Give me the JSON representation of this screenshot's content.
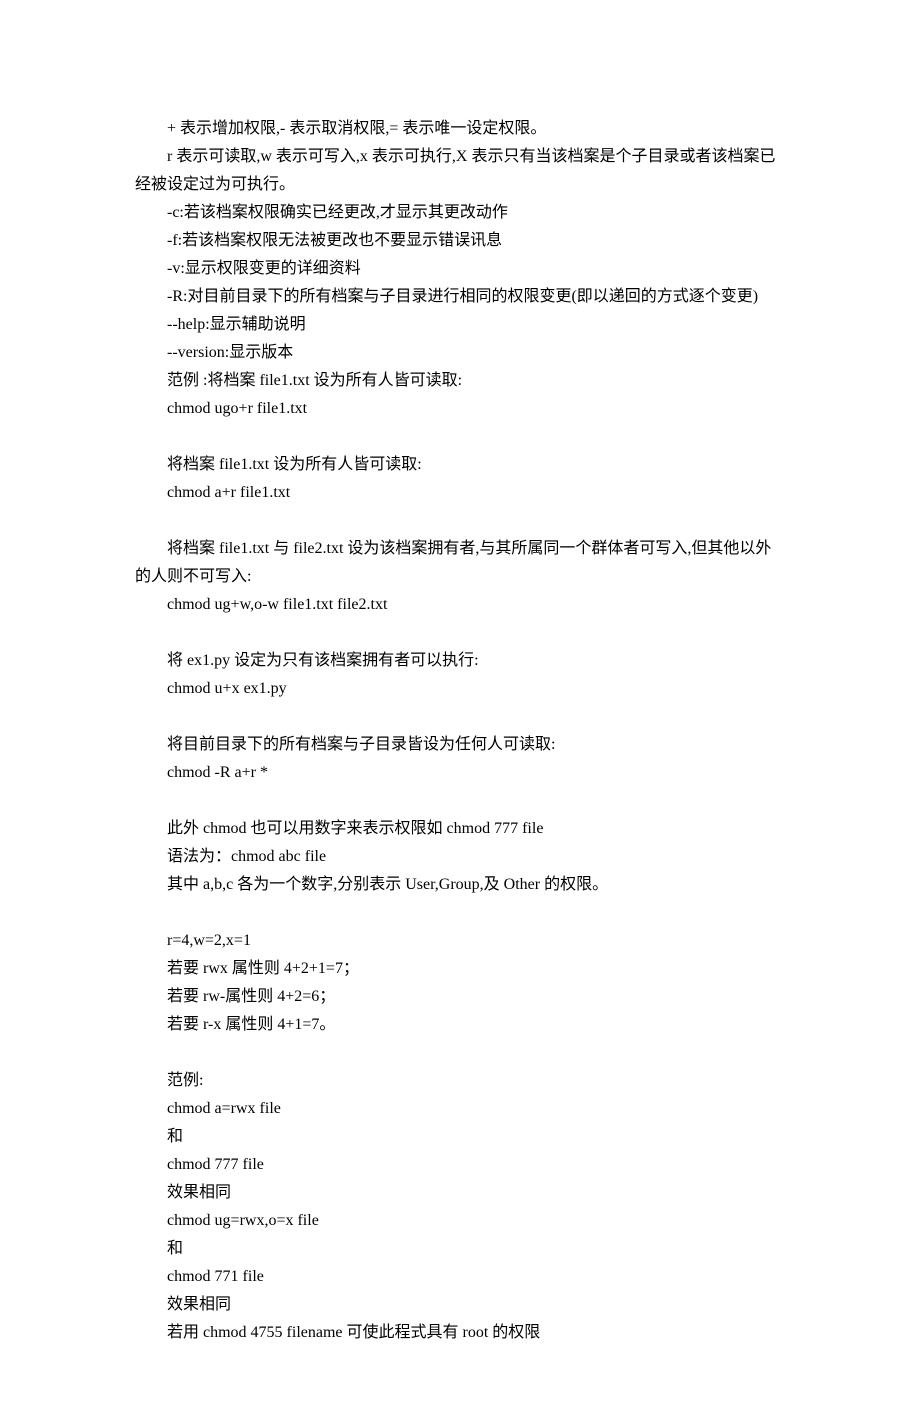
{
  "lines": [
    "+ 表示增加权限,- 表示取消权限,= 表示唯一设定权限。",
    "r 表示可读取,w 表示可写入,x 表示可执行,X 表示只有当该档案是个子目录或者该档案已经被设定过为可执行。",
    "-c:若该档案权限确实已经更改,才显示其更改动作",
    "-f:若该档案权限无法被更改也不要显示错误讯息",
    "-v:显示权限变更的详细资料",
    "-R:对目前目录下的所有档案与子目录进行相同的权限变更(即以递回的方式逐个变更)",
    "--help:显示辅助说明",
    "--version:显示版本",
    "范例 :将档案 file1.txt 设为所有人皆可读取:",
    "chmod ugo+r file1.txt",
    "",
    "将档案 file1.txt 设为所有人皆可读取:",
    "chmod a+r file1.txt",
    "",
    "将档案 file1.txt 与 file2.txt 设为该档案拥有者,与其所属同一个群体者可写入,但其他以外的人则不可写入:",
    "chmod ug+w,o-w file1.txt file2.txt",
    "",
    "将 ex1.py 设定为只有该档案拥有者可以执行:",
    "chmod u+x ex1.py",
    "",
    "将目前目录下的所有档案与子目录皆设为任何人可读取:",
    "chmod -R a+r *",
    "",
    "此外 chmod 也可以用数字来表示权限如 chmod 777 file",
    "语法为：chmod abc file",
    "其中 a,b,c 各为一个数字,分别表示 User,Group,及 Other 的权限。",
    "",
    "r=4,w=2,x=1",
    "若要 rwx 属性则 4+2+1=7；",
    "若要 rw-属性则 4+2=6；",
    "若要 r-x 属性则 4+1=7。",
    "",
    "范例:",
    "chmod a=rwx file",
    "和",
    "chmod 777 file",
    "效果相同",
    "chmod ug=rwx,o=x file",
    "和",
    "chmod 771 file",
    "效果相同",
    "若用 chmod 4755 filename 可使此程式具有 root 的权限"
  ],
  "specialWrap": {
    "1": true,
    "14": true
  }
}
